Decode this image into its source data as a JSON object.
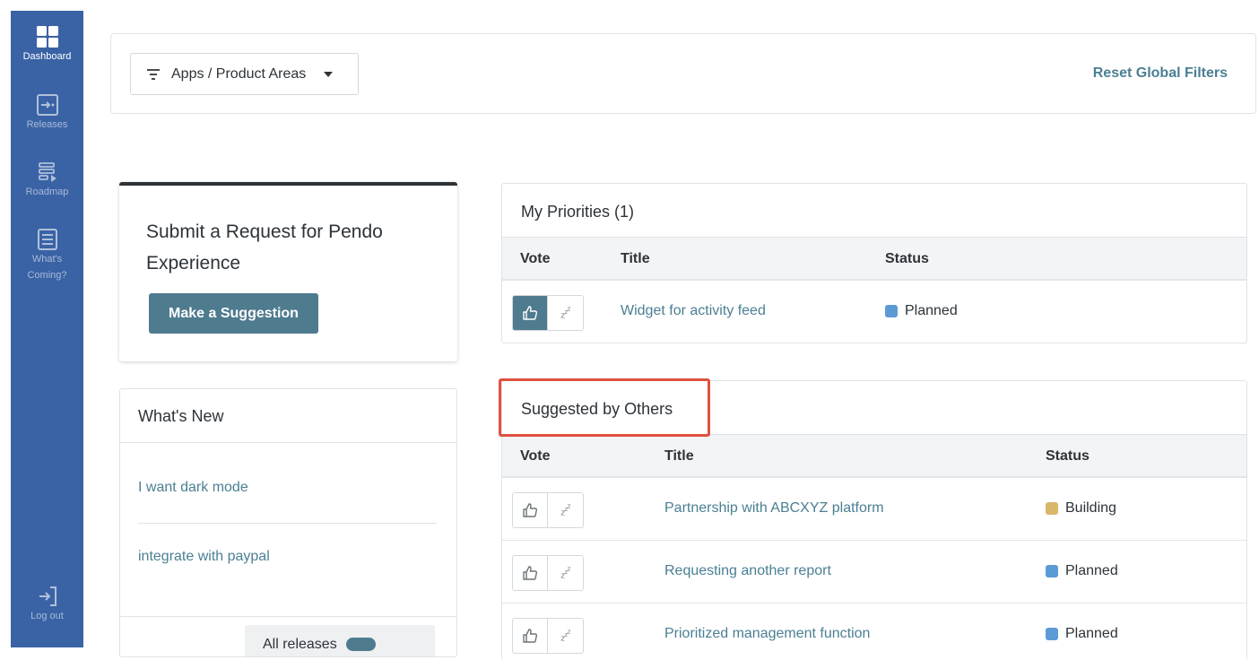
{
  "sidebar": {
    "items": [
      {
        "label": "Dashboard",
        "icon": "grid-icon",
        "active": true
      },
      {
        "label": "Releases",
        "icon": "releases-icon",
        "active": false
      },
      {
        "label": "Roadmap",
        "icon": "roadmap-icon",
        "active": false
      },
      {
        "label": "What's Coming?",
        "icon": "whats-coming-icon",
        "active": false
      }
    ],
    "logout": {
      "label": "Log out",
      "icon": "logout-icon"
    }
  },
  "filters": {
    "product_areas_label": "Apps / Product Areas",
    "reset_label": "Reset Global Filters"
  },
  "submit_card": {
    "title": "Submit a Request for Pendo Experience",
    "button_label": "Make a Suggestion"
  },
  "whats_new": {
    "title": "What's New",
    "items": [
      "I want dark mode",
      "integrate with paypal"
    ],
    "all_releases_label": "All releases"
  },
  "my_priorities": {
    "title": "My Priorities (1)",
    "columns": {
      "vote": "Vote",
      "title": "Title",
      "status": "Status"
    },
    "rows": [
      {
        "title": "Widget for activity feed",
        "status": "Planned",
        "status_color": "#5b9bd5",
        "voted": true
      }
    ]
  },
  "suggested_by_others": {
    "title": "Suggested by Others",
    "columns": {
      "vote": "Vote",
      "title": "Title",
      "status": "Status"
    },
    "rows": [
      {
        "title": "Partnership with ABCXYZ platform",
        "status": "Building",
        "status_color": "#d9b66a",
        "voted": false
      },
      {
        "title": "Requesting another report",
        "status": "Planned",
        "status_color": "#5b9bd5",
        "voted": false
      },
      {
        "title": "Prioritized management function",
        "status": "Planned",
        "status_color": "#5b9bd5",
        "voted": false
      }
    ]
  },
  "colors": {
    "sidebar": "#3a63a5",
    "accent": "#4f7b8f",
    "link": "#4a7f93",
    "highlight": "#e05141"
  }
}
